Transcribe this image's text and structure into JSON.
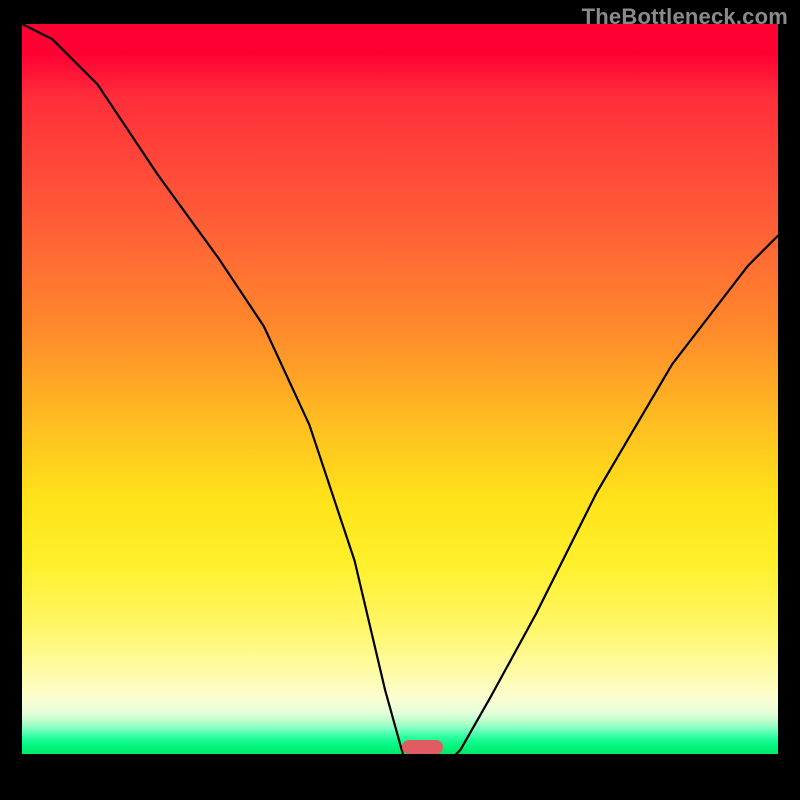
{
  "watermark": "TheBottleneck.com",
  "colors": {
    "top": "#ff0033",
    "mid": "#ffe21a",
    "bottom_green": "#00e862",
    "curve": "#000000",
    "marker": "#e15b63",
    "frame": "#000000"
  },
  "chart_data": {
    "type": "line",
    "title": "",
    "xlabel": "",
    "ylabel": "",
    "xlim": [
      0,
      100
    ],
    "ylim": [
      0,
      100
    ],
    "note": "Axes are unlabeled in the image; values are normalized 0–100 estimates of pixel-space position (y = 0 at bottom/green, 100 at top/red).",
    "series": [
      {
        "name": "bottleneck-curve",
        "x": [
          0,
          4,
          10,
          18,
          26,
          32,
          38,
          44,
          48,
          50.5,
          52,
          53.5,
          55,
          58,
          62,
          68,
          76,
          86,
          96,
          100
        ],
        "y": [
          100,
          98,
          92,
          80,
          69,
          60,
          47,
          29,
          12,
          3,
          1,
          0.5,
          1,
          4,
          11,
          22,
          38,
          55,
          68,
          72
        ]
      }
    ],
    "minimum_marker": {
      "x_center": 53,
      "x_width": 5.5,
      "y": 0.9
    },
    "gradient_stops_pct": {
      "red": 0,
      "orange": 42,
      "yellow": 74,
      "pale": 92,
      "green": 100
    }
  }
}
